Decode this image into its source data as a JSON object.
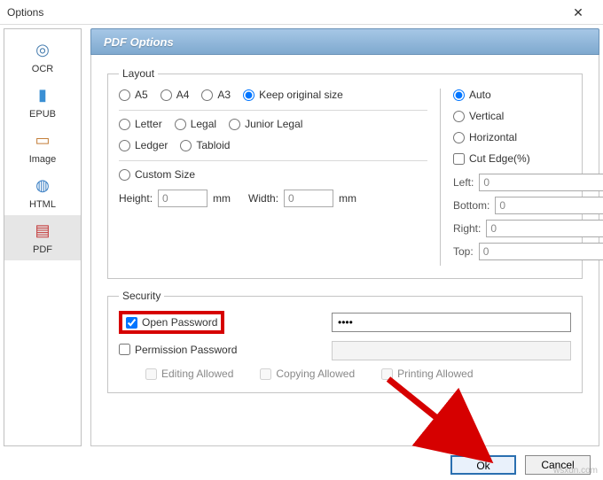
{
  "window": {
    "title": "Options",
    "close_glyph": "✕"
  },
  "sidebar": {
    "items": [
      {
        "label": "OCR",
        "icon": "ocr-icon"
      },
      {
        "label": "EPUB",
        "icon": "epub-icon"
      },
      {
        "label": "Image",
        "icon": "image-icon"
      },
      {
        "label": "HTML",
        "icon": "html-icon"
      },
      {
        "label": "PDF",
        "icon": "pdf-icon"
      }
    ],
    "selected_index": 4
  },
  "panel": {
    "title": "PDF Options"
  },
  "layout": {
    "legend": "Layout",
    "sizes": {
      "a5": "A5",
      "a4": "A4",
      "a3": "A3",
      "keep": "Keep original size",
      "letter": "Letter",
      "legal": "Legal",
      "junior": "Junior Legal",
      "ledger": "Ledger",
      "tabloid": "Tabloid",
      "custom": "Custom Size",
      "selected": "keep"
    },
    "height_label": "Height:",
    "width_label": "Width:",
    "unit": "mm",
    "height_value": "0",
    "width_value": "0",
    "orientation": {
      "auto": "Auto",
      "vertical": "Vertical",
      "horizontal": "Horizontal",
      "selected": "auto"
    },
    "cut_edge": {
      "label": "Cut Edge(%)",
      "checked": false
    },
    "margins": {
      "left_label": "Left:",
      "left": "0",
      "bottom_label": "Bottom:",
      "bottom": "0",
      "right_label": "Right:",
      "right": "0",
      "top_label": "Top:",
      "top": "0"
    }
  },
  "security": {
    "legend": "Security",
    "open_pw_label": "Open Password",
    "open_pw_checked": true,
    "open_pw_value": "••••",
    "perm_pw_label": "Permission Password",
    "perm_pw_checked": false,
    "perm_pw_value": "",
    "editing": "Editing Allowed",
    "copying": "Copying Allowed",
    "printing": "Printing Allowed"
  },
  "buttons": {
    "ok": "Ok",
    "cancel": "Cancel"
  },
  "watermark": "wsxdn.com",
  "colors": {
    "highlight": "#d60000",
    "header_grad_a": "#a6c7e6",
    "header_grad_b": "#7fa9cf",
    "primary_border": "#2a6fb0"
  }
}
